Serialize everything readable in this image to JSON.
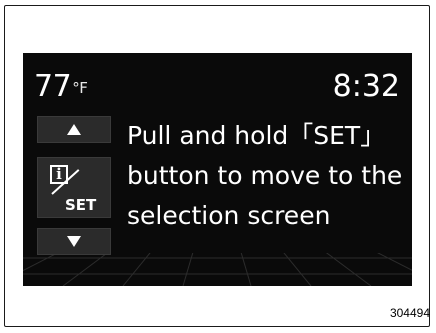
{
  "display": {
    "temperature": "77",
    "temperature_unit": "°F",
    "time": "8:32",
    "message_lines": [
      "Pull and hold「SET」",
      "button to move to the",
      "selection screen"
    ]
  },
  "controls": {
    "up_icon": "triangle-up-icon",
    "info_icon": "info-icon",
    "set_label": "SET",
    "down_icon": "triangle-down-icon"
  },
  "figure_code": "304494"
}
